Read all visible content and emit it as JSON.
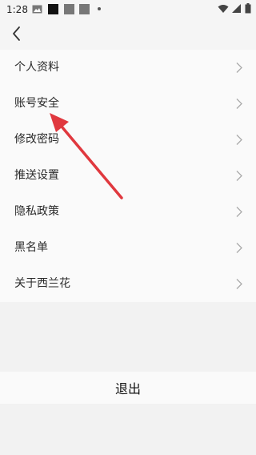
{
  "status_bar": {
    "time": "1:28",
    "left_icons": [
      "image-icon",
      "black-square-icon",
      "gray-square-icon",
      "gray-square-icon",
      "dot-icon"
    ],
    "right_icons": [
      "wifi-icon",
      "signal-icon",
      "battery-icon"
    ]
  },
  "header": {
    "back_icon": "chevron-left-icon"
  },
  "settings": {
    "items": [
      {
        "label": "个人资料"
      },
      {
        "label": "账号安全"
      },
      {
        "label": "修改密码"
      },
      {
        "label": "推送设置"
      },
      {
        "label": "隐私政策"
      },
      {
        "label": "黑名单"
      },
      {
        "label": "关于西兰花"
      }
    ]
  },
  "logout": {
    "label": "退出"
  },
  "annotation": {
    "arrow_color": "#e0383e",
    "points_to": "账号安全"
  }
}
